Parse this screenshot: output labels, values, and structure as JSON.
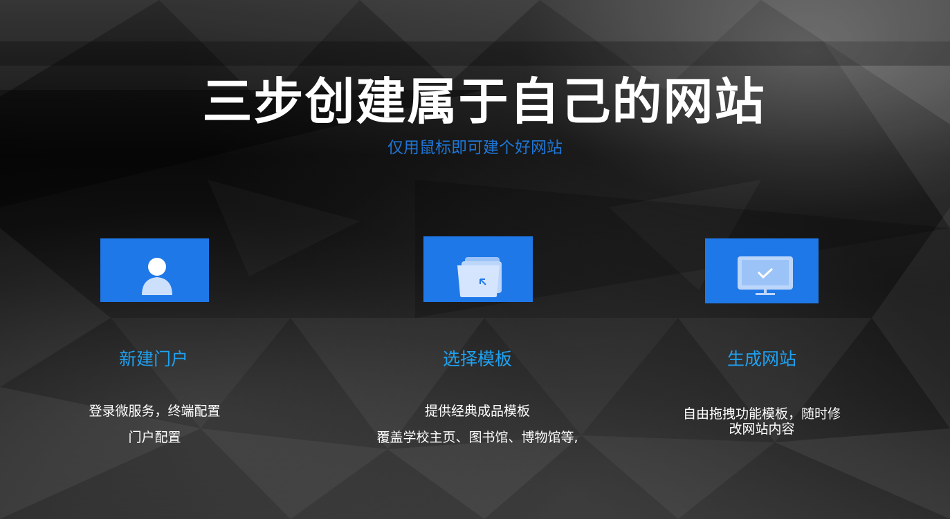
{
  "header": {
    "title": "三步创建属于自己的网站",
    "subtitle": "仅用鼠标即可建个好网站"
  },
  "steps": [
    {
      "icon": "user-icon",
      "title": "新建门户",
      "desc_lines": [
        "登录微服务，终端配置",
        "门户配置"
      ]
    },
    {
      "icon": "folder-icon",
      "title": "选择模板",
      "desc_lines": [
        "提供经典成品模板",
        "覆盖学校主页、图书馆、博物馆等,"
      ]
    },
    {
      "icon": "monitor-check-icon",
      "title": "生成网站",
      "desc_lines": [
        "自由拖拽功能模板，随时修",
        "改网站内容"
      ]
    }
  ],
  "colors": {
    "accent_blue": "#1f78e8",
    "subtitle_blue": "#1f76d6",
    "step_title_blue": "#1ea2f2",
    "text_white": "#ffffff"
  }
}
